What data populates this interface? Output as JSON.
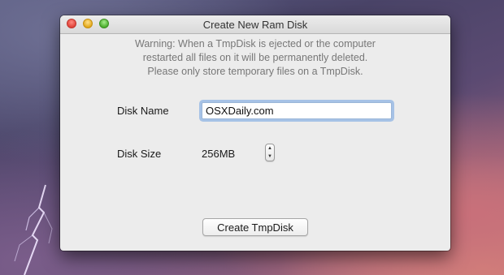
{
  "window": {
    "title": "Create New Ram Disk"
  },
  "warning": {
    "line1": "Warning: When a TmpDisk is ejected or the computer",
    "line2": "restarted all files on it will be permanently deleted.",
    "line3": "Please only store temporary files on a TmpDisk."
  },
  "form": {
    "disk_name_label": "Disk Name",
    "disk_name_value": "OSXDaily.com",
    "disk_size_label": "Disk Size",
    "disk_size_value": "256MB"
  },
  "actions": {
    "create_label": "Create TmpDisk"
  },
  "icons": {
    "stepper_up": "triangle-up-icon",
    "stepper_down": "triangle-down-icon"
  },
  "colors": {
    "focus_ring": "#6ea0e1",
    "close": "#e0443a",
    "minimize": "#e3a91b",
    "zoom": "#4cae2e"
  }
}
